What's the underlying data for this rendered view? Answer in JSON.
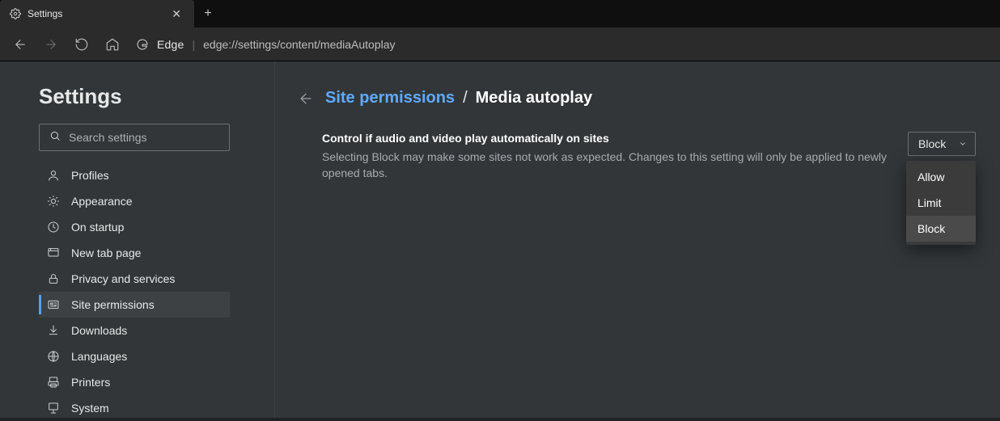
{
  "tab": {
    "title": "Settings"
  },
  "addressbar": {
    "label": "Edge",
    "url": "edge://settings/content/mediaAutoplay"
  },
  "sidebar": {
    "heading": "Settings",
    "search_placeholder": "Search settings",
    "items": [
      {
        "label": "Profiles"
      },
      {
        "label": "Appearance"
      },
      {
        "label": "On startup"
      },
      {
        "label": "New tab page"
      },
      {
        "label": "Privacy and services"
      },
      {
        "label": "Site permissions"
      },
      {
        "label": "Downloads"
      },
      {
        "label": "Languages"
      },
      {
        "label": "Printers"
      },
      {
        "label": "System"
      }
    ],
    "active_index": 5
  },
  "breadcrumb": {
    "parent": "Site permissions",
    "separator": "/",
    "current": "Media autoplay"
  },
  "setting": {
    "title": "Control if audio and video play automatically on sites",
    "description": "Selecting Block may make some sites not work as expected. Changes to this setting will only be applied to newly opened tabs.",
    "value": "Block",
    "options": [
      "Allow",
      "Limit",
      "Block"
    ]
  }
}
